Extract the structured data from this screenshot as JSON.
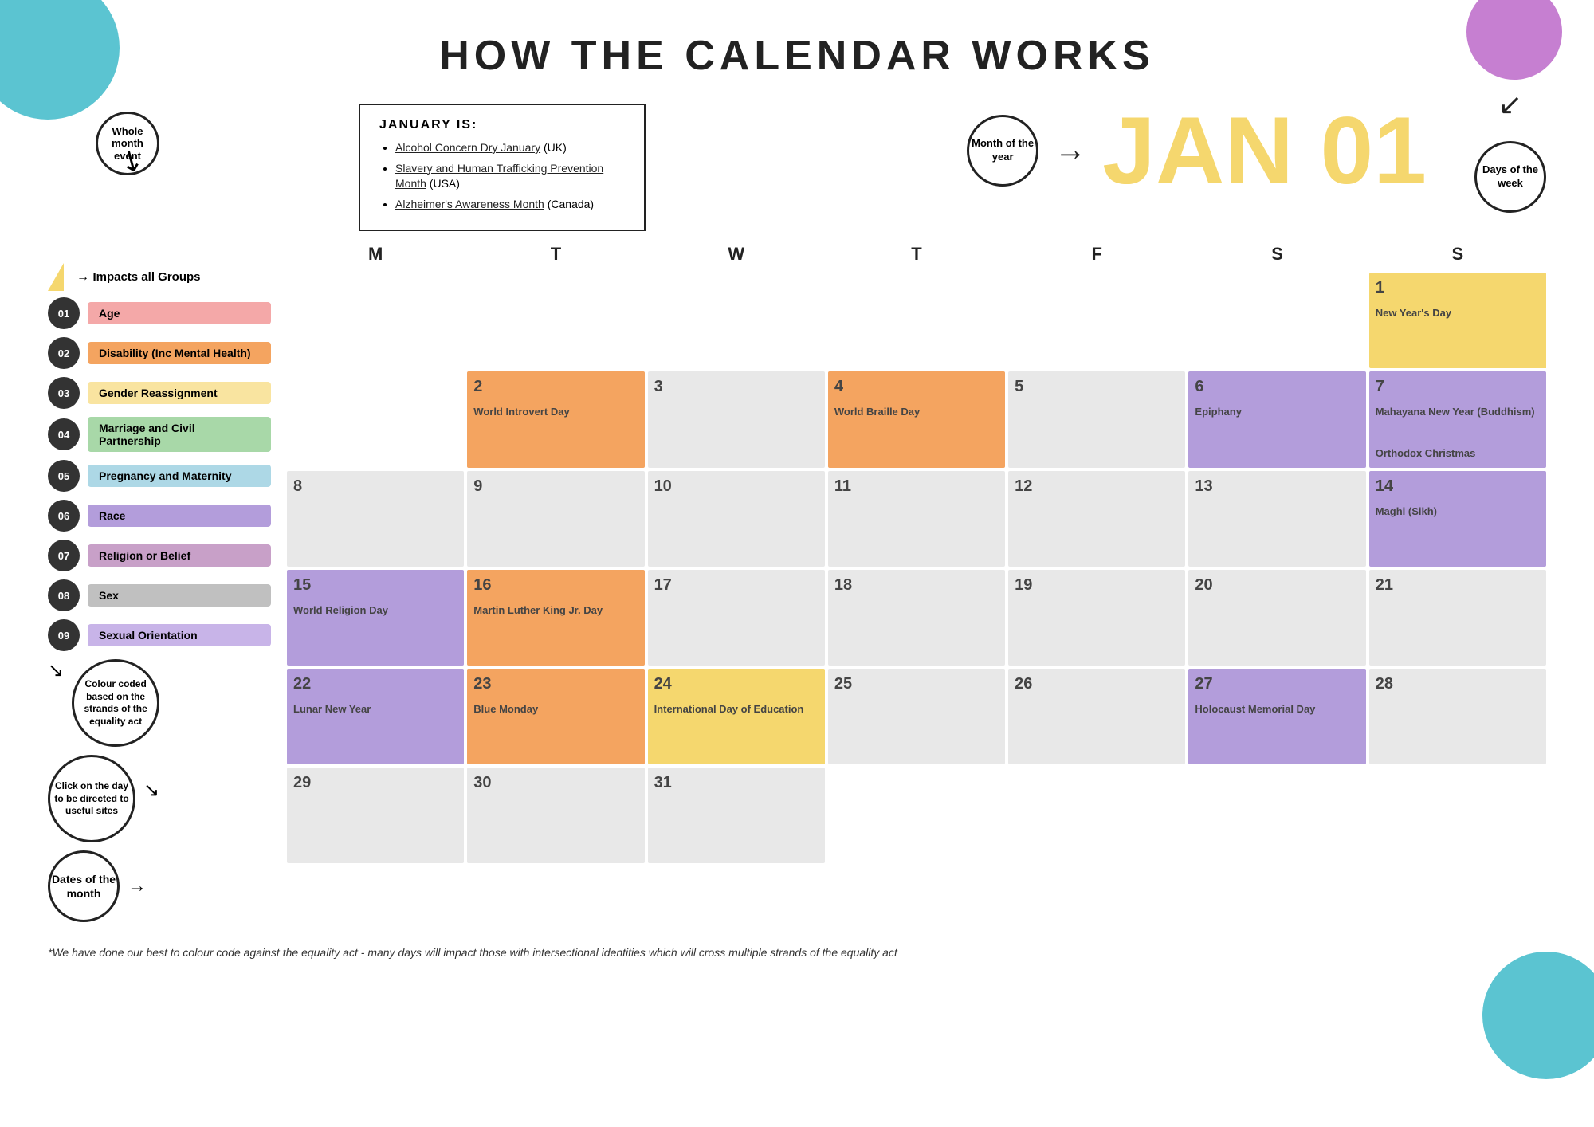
{
  "title": "HOW THE CALENDAR WORKS",
  "subtitle_jan": "JAN 01",
  "month_bubble_label": "Month of the year",
  "days_bubble_label": "Days of the week",
  "whole_month_label": "Whole month event",
  "january_heading": "JANUARY IS:",
  "january_events": [
    {
      "text": "Alcohol Concern Dry January",
      "suffix": " (UK)"
    },
    {
      "text": "Slavery and Human Trafficking Prevention Month",
      "suffix": " (USA)"
    },
    {
      "text": "Alzheimer's Awareness Month",
      "suffix": " (Canada)"
    }
  ],
  "colour_annotation": "Colour coded based on the strands of the equality act",
  "click_annotation": "Click on the day to be directed to useful sites",
  "dates_annotation": "Dates of the month",
  "impacts_label": "Impacts all Groups",
  "legend": [
    {
      "num": "01",
      "label": "Age",
      "color": "#f4a8a8"
    },
    {
      "num": "02",
      "label": "Disability (Inc Mental Health)",
      "color": "#f4a460"
    },
    {
      "num": "03",
      "label": "Gender Reassignment",
      "color": "#f9e4a0"
    },
    {
      "num": "04",
      "label": "Marriage and Civil Partnership",
      "color": "#a8d8a8"
    },
    {
      "num": "05",
      "label": "Pregnancy and Maternity",
      "color": "#add8e6"
    },
    {
      "num": "06",
      "label": "Race",
      "color": "#b39ddb"
    },
    {
      "num": "07",
      "label": "Religion or Belief",
      "color": "#c8a0c8"
    },
    {
      "num": "08",
      "label": "Sex",
      "color": "#c0c0c0"
    },
    {
      "num": "09",
      "label": "Sexual Orientation",
      "color": "#c8b4e8"
    }
  ],
  "days_of_week": [
    "M",
    "T",
    "W",
    "T",
    "F",
    "S",
    "S"
  ],
  "calendar_cells": [
    {
      "day": "",
      "event": "",
      "color": "empty"
    },
    {
      "day": "2",
      "event": "World Introvert Day",
      "color": "orange"
    },
    {
      "day": "3",
      "event": "",
      "color": "plain"
    },
    {
      "day": "4",
      "event": "World Braille Day",
      "color": "orange"
    },
    {
      "day": "5",
      "event": "",
      "color": "plain"
    },
    {
      "day": "6",
      "event": "Epiphany",
      "color": "purple"
    },
    {
      "day": "7",
      "event": "Mahayana New Year (Buddhism)\n\nOrthodox Christmas",
      "color": "purple"
    },
    {
      "day": "8",
      "event": "",
      "color": "plain"
    },
    {
      "day": "9",
      "event": "",
      "color": "plain"
    },
    {
      "day": "10",
      "event": "",
      "color": "plain"
    },
    {
      "day": "11",
      "event": "",
      "color": "plain"
    },
    {
      "day": "12",
      "event": "",
      "color": "plain"
    },
    {
      "day": "13",
      "event": "",
      "color": "plain"
    },
    {
      "day": "14",
      "event": "Maghi (Sikh)",
      "color": "purple"
    },
    {
      "day": "15",
      "event": "World Religion Day",
      "color": "purple"
    },
    {
      "day": "16",
      "event": "Martin Luther King Jr. Day",
      "color": "orange"
    },
    {
      "day": "17",
      "event": "",
      "color": "plain"
    },
    {
      "day": "18",
      "event": "",
      "color": "plain"
    },
    {
      "day": "19",
      "event": "",
      "color": "plain"
    },
    {
      "day": "20",
      "event": "",
      "color": "plain"
    },
    {
      "day": "21",
      "event": "",
      "color": "plain"
    },
    {
      "day": "22",
      "event": "Lunar New Year",
      "color": "purple"
    },
    {
      "day": "23",
      "event": "Blue Monday",
      "color": "orange"
    },
    {
      "day": "24",
      "event": "International Day of Education",
      "color": "yellow"
    },
    {
      "day": "25",
      "event": "",
      "color": "plain"
    },
    {
      "day": "26",
      "event": "",
      "color": "plain"
    },
    {
      "day": "27",
      "event": "Holocaust Memorial Day",
      "color": "purple"
    },
    {
      "day": "28",
      "event": "",
      "color": "plain"
    },
    {
      "day": "29",
      "event": "",
      "color": "plain"
    },
    {
      "day": "30",
      "event": "",
      "color": "plain"
    },
    {
      "day": "31",
      "event": "",
      "color": "plain"
    },
    {
      "day": "",
      "event": "",
      "color": "empty"
    },
    {
      "day": "",
      "event": "",
      "color": "empty"
    },
    {
      "day": "",
      "event": "",
      "color": "empty"
    },
    {
      "day": "",
      "event": "",
      "color": "empty"
    }
  ],
  "row1_special": {
    "day": "1",
    "event": "New Year's Day",
    "color": "yellow",
    "has_triangle": true
  },
  "footnote": "*We have done our best to colour code against the equality act - many days will impact those with intersectional identities which will cross multiple strands of the equality act"
}
